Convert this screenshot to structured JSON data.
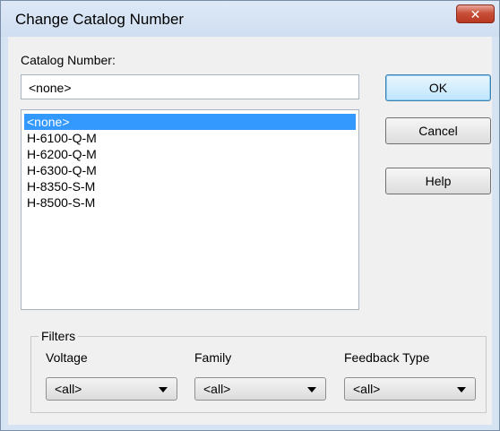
{
  "dialog": {
    "title": "Change Catalog Number",
    "close_glyph": "✕",
    "catalog_label": "Catalog Number:",
    "catalog_value": "<none>",
    "list_items": [
      "<none>",
      "H-6100-Q-M",
      "H-6200-Q-M",
      "H-6300-Q-M",
      "H-8350-S-M",
      "H-8500-S-M"
    ],
    "selected_index": 0
  },
  "buttons": {
    "ok": "OK",
    "cancel": "Cancel",
    "help": "Help"
  },
  "filters": {
    "legend": "Filters",
    "voltage_label": "Voltage",
    "voltage_value": "<all>",
    "family_label": "Family",
    "family_value": "<all>",
    "feedback_label": "Feedback Type",
    "feedback_value": "<all>"
  },
  "icons": {
    "close": "close-icon",
    "dropdown": "chevron-down-icon"
  },
  "colors": {
    "selection": "#3399ff",
    "close_button": "#c9503a",
    "window_frame": "#d6e3f3"
  }
}
